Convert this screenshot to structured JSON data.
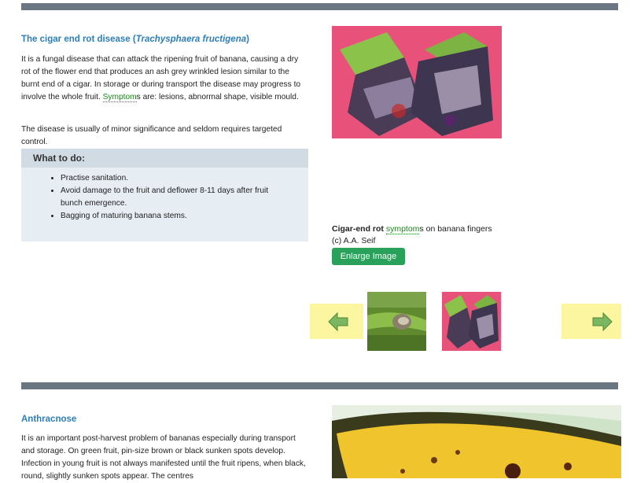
{
  "section1": {
    "title_main": "The cigar end rot disease (",
    "title_latin": "Trachysphaera fructigena",
    "title_close": ")",
    "para1_a": "It is a fungal disease that can attack the ripening fruit of banana, causing a dry rot of the flower end that produces an ash grey wrinkled lesion similar to the burnt end of a cigar. In storage or during transport the disease may progress to involve the whole fruit. ",
    "para1_link": "Symptom",
    "para1_b": "s are: lesions, abnormal shape, visible mould.",
    "para2": "The disease is usually of minor significance and seldom requires targeted control.",
    "todo_title": "What to do:",
    "todo_items": [
      "Practise sanitation.",
      "Avoid damage to the fruit and deflower 8-11 days after fruit bunch emergence.",
      "Bagging of maturing banana stems."
    ],
    "caption_bold": "Cigar-end rot ",
    "caption_link": "symptom",
    "caption_rest": "s on banana fingers",
    "caption_credit": "(c) A.A. Seif",
    "enlarge_label": "Enlarge Image"
  },
  "section2": {
    "title": "Anthracnose",
    "para": "It is an important post-harvest problem of bananas especially during transport and storage. On green fruit, pin-size brown or black sunken spots develop. Infection in young fruit is not always manifested until the fruit ripens, when black, round, slightly sunken spots appear. The centres"
  },
  "colors": {
    "bar": "#6b7683",
    "title": "#2c7fb8",
    "link": "#1a8a1a",
    "button": "#2aa15a",
    "nav_bg": "#fdf6a1",
    "arrow": "#6aa84f"
  },
  "icons": {
    "prev": "left-arrow-icon",
    "next": "right-arrow-icon"
  }
}
